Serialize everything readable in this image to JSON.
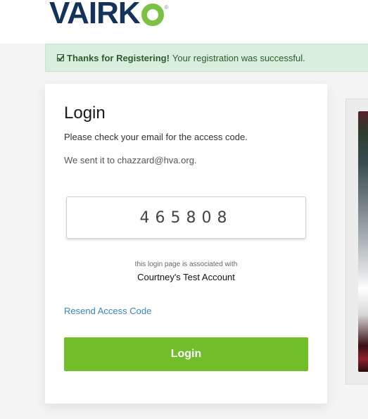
{
  "brand": {
    "logo_text_left": "VAIRK",
    "logo_accent": "#7bc142",
    "logo_primary": "#14325a",
    "trademark": "®"
  },
  "alert": {
    "icon": "check-square-icon",
    "title": "Thanks for Registering!",
    "message": "Your registration was successful.",
    "bg_color": "#d9eedc"
  },
  "login": {
    "title": "Login",
    "instruction": "Please check your email for the access code.",
    "sent_to": "We sent it to chazzard@hva.org.",
    "code_value": "465808",
    "association_note": "this login page is associated with",
    "account_name": "Courtney's Test Account",
    "resend_link": "Resend Access Code",
    "button_label": "Login",
    "button_color": "#6fbe2a",
    "link_color": "#3a86c0"
  }
}
